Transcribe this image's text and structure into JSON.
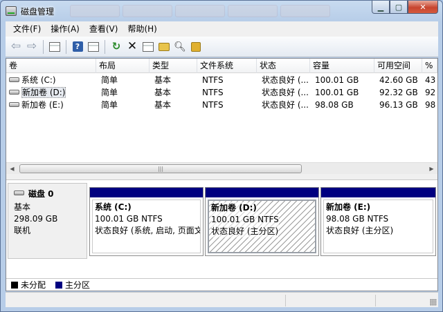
{
  "window": {
    "title": "磁盘管理"
  },
  "menu": [
    "文件(F)",
    "操作(A)",
    "查看(V)",
    "帮助(H)"
  ],
  "toolbar": {
    "icons": [
      "back-arrow-icon",
      "forward-arrow-icon",
      "show-hide-pane-icon",
      "help-icon",
      "properties-pane-icon",
      "refresh-icon",
      "delete-icon",
      "properties-icon",
      "open-icon",
      "explore-icon",
      "help-book-icon"
    ]
  },
  "volume_table": {
    "columns": [
      "卷",
      "布局",
      "类型",
      "文件系统",
      "状态",
      "容量",
      "可用空间",
      "%"
    ],
    "rows": [
      {
        "volume": "系统 (C:)",
        "layout": "简单",
        "type": "基本",
        "fs": "NTFS",
        "status": "状态良好 (...",
        "capacity": "100.01 GB",
        "free": "42.60 GB",
        "pct": "43"
      },
      {
        "volume": "新加卷 (D:)",
        "layout": "简单",
        "type": "基本",
        "fs": "NTFS",
        "status": "状态良好 (...",
        "capacity": "100.01 GB",
        "free": "92.32 GB",
        "pct": "92"
      },
      {
        "volume": "新加卷 (E:)",
        "layout": "简单",
        "type": "基本",
        "fs": "NTFS",
        "status": "状态良好 (...",
        "capacity": "98.08 GB",
        "free": "96.13 GB",
        "pct": "98"
      }
    ]
  },
  "disk": {
    "name": "磁盘 0",
    "type": "基本",
    "size": "298.09 GB",
    "state": "联机",
    "partitions": [
      {
        "name": "系统   (C:)",
        "size_fs": "100.01 GB NTFS",
        "status": "状态良好 (系统, 启动, 页面文"
      },
      {
        "name": "新加卷   (D:)",
        "size_fs": "100.01 GB NTFS",
        "status": "状态良好 (主分区)"
      },
      {
        "name": "新加卷   (E:)",
        "size_fs": "98.08 GB NTFS",
        "status": "状态良好 (主分区)"
      }
    ]
  },
  "legend": [
    {
      "label": "未分配",
      "color": "#000000"
    },
    {
      "label": "主分区",
      "color": "#000080"
    }
  ],
  "colors": {
    "primary_partition": "#000080",
    "unallocated": "#000000"
  }
}
